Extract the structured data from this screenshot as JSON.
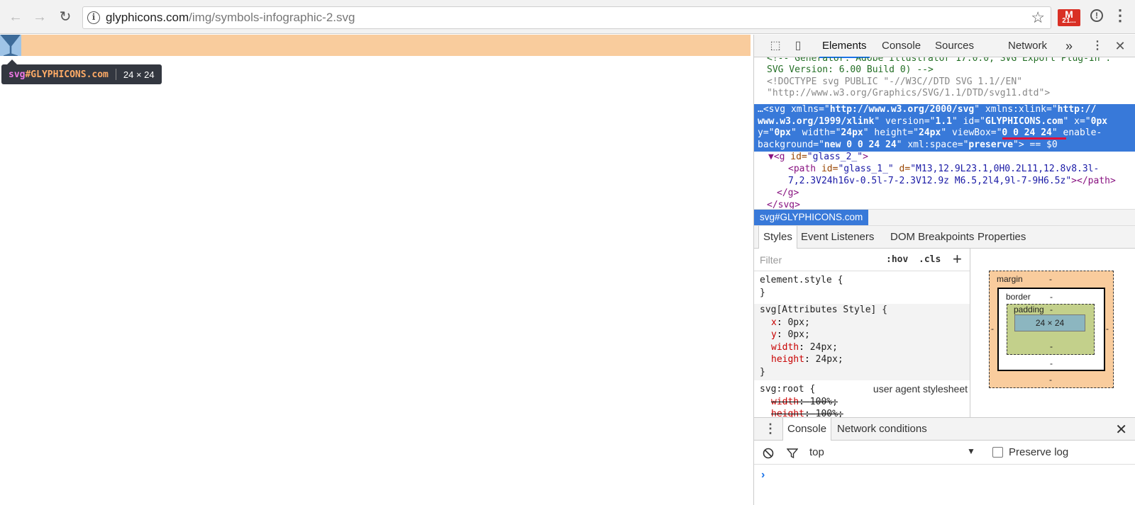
{
  "browser": {
    "url_domain": "glyphicons.com",
    "url_path": "/img/symbols-infographic-2.svg",
    "gmail_badge": "21...",
    "icons": {
      "back": "arrow-left-icon",
      "forward": "arrow-right-icon",
      "reload": "reload-icon",
      "info": "info-icon",
      "star": "star-icon",
      "gmail": "gmail-icon",
      "ext": "extension-icon",
      "menu": "kebab-icon"
    }
  },
  "page": {
    "tooltip": {
      "tag": "svg",
      "id": "#GLYPHICONS.com",
      "size": "24 × 24"
    },
    "colors": {
      "highlight": "#f9cc9d",
      "element": "#9fc4e7"
    }
  },
  "devtools": {
    "tabs": [
      "Elements",
      "Console",
      "Sources",
      "Network"
    ],
    "more": "»",
    "elements": {
      "comment1": "<!-- Generator: Adobe Illustrator 17.0.0, SVG Export Plug-In .",
      "comment2": "SVG Version: 6.00 Build 0)  -->",
      "doctype1": "<!DOCTYPE svg PUBLIC \"-//W3C//DTD SVG 1.1//EN\"",
      "doctype2": "\"http://www.w3.org/Graphics/SVG/1.1/DTD/svg11.dtd\">",
      "sel1_a": "…<svg xmlns=\"",
      "sel1_b": "http://www.w3.org/2000/svg",
      "sel1_c": "\" xmlns:xlink=\"",
      "sel1_d": "http://",
      "sel2_a": "www.w3.org/1999/xlink",
      "sel2_b": "\" version=\"",
      "sel2_c": "1.1",
      "sel2_d": "\" id=\"",
      "sel2_e": "GLYPHICONS.com",
      "sel2_f": "\" x=\"",
      "sel2_g": "0px",
      "sel3_a": "y=\"",
      "sel3_b": "0px",
      "sel3_c": "\" width=\"",
      "sel3_d": "24px",
      "sel3_e": "\" height=\"",
      "sel3_f": "24px",
      "sel3_g": "\" viewBox=\"",
      "sel3_h": "0 0 24 24",
      "sel3_i": "\" enable-",
      "sel4_a": "background=\"",
      "sel4_b": "new 0 0 24 24",
      "sel4_c": "\" xml:space=\"",
      "sel4_d": "preserve",
      "sel4_e": "\"> == $0",
      "g_open_tag": "▼<g",
      "g_open_attr": " id=",
      "g_open_val": "\"glass_2_\"",
      "g_open_end": ">",
      "path1_tag": "<path",
      "path1_attr1": " id=",
      "path1_val1": "\"glass_1_\"",
      "path1_attr2": " d=",
      "path1_val2": "\"M13,12.9L23.1,0H0.2L11,12.8v8.3l-",
      "path2_val": "7,2.3V24h16v-0.5l-7-2.3V12.9z M6.5,2l4,9l-7-9H6.5z\"",
      "path2_end": "></path>",
      "g_close": "</g>",
      "svg_close": "</svg>"
    },
    "breadcrumb": "svg#GLYPHICONS.com",
    "subtabs": [
      "Styles",
      "Event Listeners",
      "DOM Breakpoints",
      "Properties"
    ],
    "styles": {
      "filter_placeholder": "Filter",
      "hov": ":hov",
      "cls": ".cls",
      "plus": "+",
      "element_style_sel": "element.style {",
      "close_brace": "}",
      "attr_sel": "svg[Attributes Style] {",
      "p_x": "x",
      "v_x": "0px;",
      "p_y": "y",
      "v_y": "0px;",
      "p_w": "width",
      "v_w": "24px;",
      "p_h": "height",
      "v_h": "24px;",
      "root_sel": "svg:root {",
      "ua": "user agent stylesheet",
      "p_w2": "width",
      "v_w2": "100%;",
      "p_h2": "height",
      "v_h2": "100%;"
    },
    "boxmodel": {
      "margin": "margin",
      "border": "border",
      "padding": "padding",
      "dash": "-",
      "content": "24 × 24"
    },
    "drawer": {
      "tabs": [
        "Console",
        "Network conditions"
      ],
      "context": "top",
      "preserve": "Preserve log",
      "prompt": "›"
    }
  }
}
